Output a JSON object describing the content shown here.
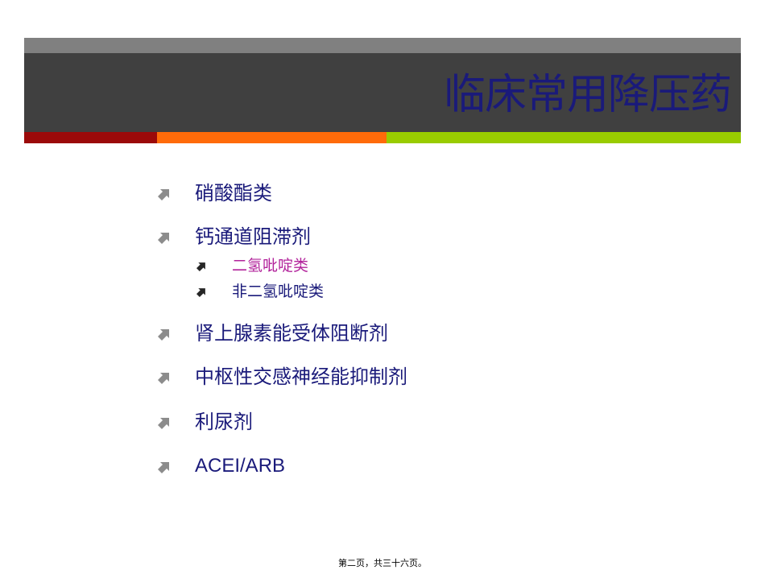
{
  "slide": {
    "title": "临床常用降压药",
    "footer": "第二页，共三十六页。"
  },
  "colors": {
    "header_strip": "#808080",
    "header_band": "#404040",
    "title": "#1a1a7a",
    "accent_1": "#9b0a0a",
    "accent_2": "#ff6b0a",
    "accent_3": "#99cc00",
    "bullet_icon": "#8c8c8c",
    "sub_bullet_icon": "#262626",
    "highlight_text": "#b2239b",
    "body_text": "#1a1a7a"
  },
  "bullets": [
    {
      "text": "硝酸酯类",
      "level": 1,
      "icon": "up-right-arrow-icon"
    },
    {
      "text": "钙通道阻滞剂",
      "level": 1,
      "icon": "up-right-arrow-icon",
      "children": [
        {
          "text": "二氢吡啶类",
          "level": 2,
          "icon": "up-right-arrow-icon",
          "highlighted": true
        },
        {
          "text": "非二氢吡啶类",
          "level": 2,
          "icon": "up-right-arrow-icon",
          "highlighted": false
        }
      ]
    },
    {
      "text": "肾上腺素能受体阻断剂",
      "level": 1,
      "icon": "up-right-arrow-icon"
    },
    {
      "text": "中枢性交感神经能抑制剂",
      "level": 1,
      "icon": "up-right-arrow-icon"
    },
    {
      "text": "利尿剂",
      "level": 1,
      "icon": "up-right-arrow-icon"
    },
    {
      "text": "ACEI/ARB",
      "level": 1,
      "icon": "up-right-arrow-icon"
    }
  ]
}
